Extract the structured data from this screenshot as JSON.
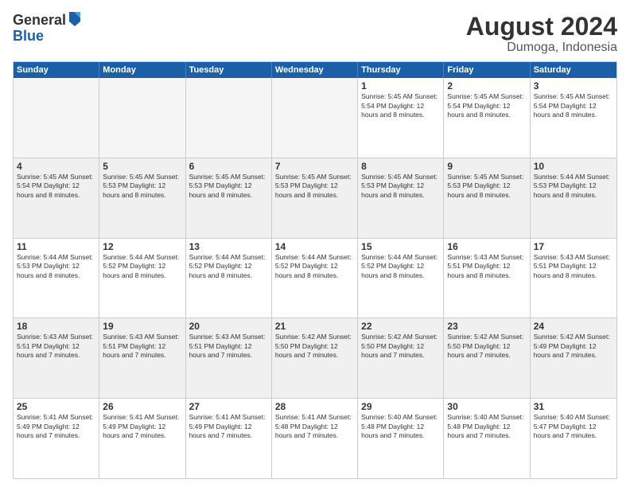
{
  "logo": {
    "general": "General",
    "blue": "Blue"
  },
  "header": {
    "month_year": "August 2024",
    "location": "Dumoga, Indonesia"
  },
  "weekdays": [
    "Sunday",
    "Monday",
    "Tuesday",
    "Wednesday",
    "Thursday",
    "Friday",
    "Saturday"
  ],
  "rows": [
    [
      {
        "day": "",
        "info": "",
        "empty": true
      },
      {
        "day": "",
        "info": "",
        "empty": true
      },
      {
        "day": "",
        "info": "",
        "empty": true
      },
      {
        "day": "",
        "info": "",
        "empty": true
      },
      {
        "day": "1",
        "info": "Sunrise: 5:45 AM\nSunset: 5:54 PM\nDaylight: 12 hours\nand 8 minutes.",
        "empty": false
      },
      {
        "day": "2",
        "info": "Sunrise: 5:45 AM\nSunset: 5:54 PM\nDaylight: 12 hours\nand 8 minutes.",
        "empty": false
      },
      {
        "day": "3",
        "info": "Sunrise: 5:45 AM\nSunset: 5:54 PM\nDaylight: 12 hours\nand 8 minutes.",
        "empty": false
      }
    ],
    [
      {
        "day": "4",
        "info": "Sunrise: 5:45 AM\nSunset: 5:54 PM\nDaylight: 12 hours\nand 8 minutes.",
        "empty": false
      },
      {
        "day": "5",
        "info": "Sunrise: 5:45 AM\nSunset: 5:53 PM\nDaylight: 12 hours\nand 8 minutes.",
        "empty": false
      },
      {
        "day": "6",
        "info": "Sunrise: 5:45 AM\nSunset: 5:53 PM\nDaylight: 12 hours\nand 8 minutes.",
        "empty": false
      },
      {
        "day": "7",
        "info": "Sunrise: 5:45 AM\nSunset: 5:53 PM\nDaylight: 12 hours\nand 8 minutes.",
        "empty": false
      },
      {
        "day": "8",
        "info": "Sunrise: 5:45 AM\nSunset: 5:53 PM\nDaylight: 12 hours\nand 8 minutes.",
        "empty": false
      },
      {
        "day": "9",
        "info": "Sunrise: 5:45 AM\nSunset: 5:53 PM\nDaylight: 12 hours\nand 8 minutes.",
        "empty": false
      },
      {
        "day": "10",
        "info": "Sunrise: 5:44 AM\nSunset: 5:53 PM\nDaylight: 12 hours\nand 8 minutes.",
        "empty": false
      }
    ],
    [
      {
        "day": "11",
        "info": "Sunrise: 5:44 AM\nSunset: 5:53 PM\nDaylight: 12 hours\nand 8 minutes.",
        "empty": false
      },
      {
        "day": "12",
        "info": "Sunrise: 5:44 AM\nSunset: 5:52 PM\nDaylight: 12 hours\nand 8 minutes.",
        "empty": false
      },
      {
        "day": "13",
        "info": "Sunrise: 5:44 AM\nSunset: 5:52 PM\nDaylight: 12 hours\nand 8 minutes.",
        "empty": false
      },
      {
        "day": "14",
        "info": "Sunrise: 5:44 AM\nSunset: 5:52 PM\nDaylight: 12 hours\nand 8 minutes.",
        "empty": false
      },
      {
        "day": "15",
        "info": "Sunrise: 5:44 AM\nSunset: 5:52 PM\nDaylight: 12 hours\nand 8 minutes.",
        "empty": false
      },
      {
        "day": "16",
        "info": "Sunrise: 5:43 AM\nSunset: 5:51 PM\nDaylight: 12 hours\nand 8 minutes.",
        "empty": false
      },
      {
        "day": "17",
        "info": "Sunrise: 5:43 AM\nSunset: 5:51 PM\nDaylight: 12 hours\nand 8 minutes.",
        "empty": false
      }
    ],
    [
      {
        "day": "18",
        "info": "Sunrise: 5:43 AM\nSunset: 5:51 PM\nDaylight: 12 hours\nand 7 minutes.",
        "empty": false
      },
      {
        "day": "19",
        "info": "Sunrise: 5:43 AM\nSunset: 5:51 PM\nDaylight: 12 hours\nand 7 minutes.",
        "empty": false
      },
      {
        "day": "20",
        "info": "Sunrise: 5:43 AM\nSunset: 5:51 PM\nDaylight: 12 hours\nand 7 minutes.",
        "empty": false
      },
      {
        "day": "21",
        "info": "Sunrise: 5:42 AM\nSunset: 5:50 PM\nDaylight: 12 hours\nand 7 minutes.",
        "empty": false
      },
      {
        "day": "22",
        "info": "Sunrise: 5:42 AM\nSunset: 5:50 PM\nDaylight: 12 hours\nand 7 minutes.",
        "empty": false
      },
      {
        "day": "23",
        "info": "Sunrise: 5:42 AM\nSunset: 5:50 PM\nDaylight: 12 hours\nand 7 minutes.",
        "empty": false
      },
      {
        "day": "24",
        "info": "Sunrise: 5:42 AM\nSunset: 5:49 PM\nDaylight: 12 hours\nand 7 minutes.",
        "empty": false
      }
    ],
    [
      {
        "day": "25",
        "info": "Sunrise: 5:41 AM\nSunset: 5:49 PM\nDaylight: 12 hours\nand 7 minutes.",
        "empty": false
      },
      {
        "day": "26",
        "info": "Sunrise: 5:41 AM\nSunset: 5:49 PM\nDaylight: 12 hours\nand 7 minutes.",
        "empty": false
      },
      {
        "day": "27",
        "info": "Sunrise: 5:41 AM\nSunset: 5:49 PM\nDaylight: 12 hours\nand 7 minutes.",
        "empty": false
      },
      {
        "day": "28",
        "info": "Sunrise: 5:41 AM\nSunset: 5:48 PM\nDaylight: 12 hours\nand 7 minutes.",
        "empty": false
      },
      {
        "day": "29",
        "info": "Sunrise: 5:40 AM\nSunset: 5:48 PM\nDaylight: 12 hours\nand 7 minutes.",
        "empty": false
      },
      {
        "day": "30",
        "info": "Sunrise: 5:40 AM\nSunset: 5:48 PM\nDaylight: 12 hours\nand 7 minutes.",
        "empty": false
      },
      {
        "day": "31",
        "info": "Sunrise: 5:40 AM\nSunset: 5:47 PM\nDaylight: 12 hours\nand 7 minutes.",
        "empty": false
      }
    ]
  ]
}
